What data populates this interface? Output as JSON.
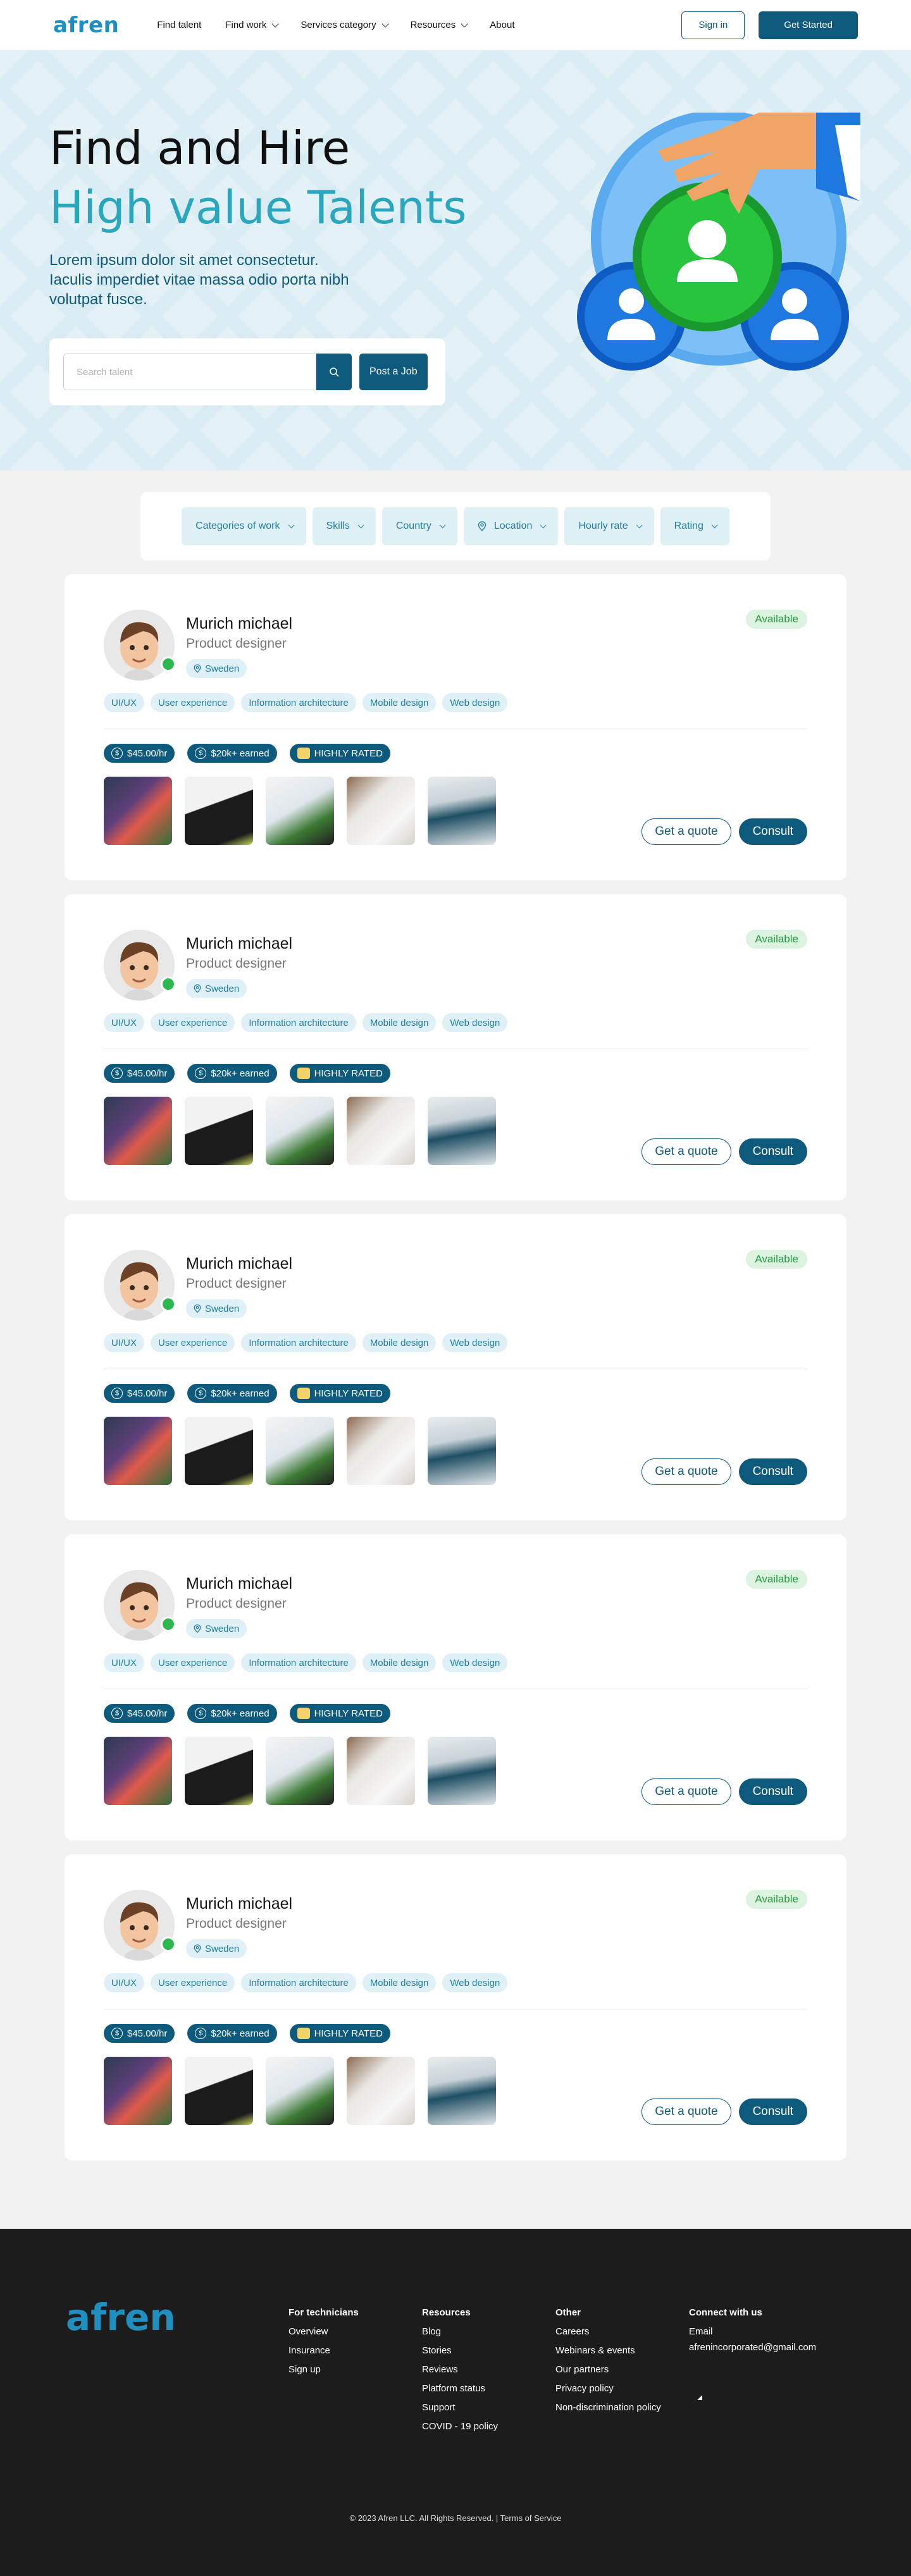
{
  "nav": {
    "logo": "afren",
    "links": [
      "Find talent",
      "Find work",
      "Services category",
      "Resources",
      "About"
    ],
    "signin": "Sign in",
    "get_started": "Get Started"
  },
  "hero": {
    "title_line1": "Find and Hire",
    "title_line2": "High value Talents",
    "subtitle": "Lorem ipsum dolor sit amet consectetur. Iaculis imperdiet vitae massa odio porta nibh volutpat fusce.",
    "search_placeholder": "Search talent",
    "post_job": "Post a Job"
  },
  "filters": [
    "Categories of work",
    "Skills",
    "Country",
    "Location",
    "Hourly rate",
    "Rating"
  ],
  "talents": [
    {
      "name": "Murich michael",
      "role": "Product designer",
      "location": "Sweden",
      "status": "Available",
      "skills": [
        "UI/UX",
        "User experience",
        "Information architecture",
        "Mobile design",
        "Web design"
      ],
      "rate": "$45.00/hr",
      "earned": "$20k+ earned",
      "badge": "HIGHLY RATED",
      "quote": "Get a quote",
      "consult": "Consult"
    },
    {
      "name": "Murich michael",
      "role": "Product designer",
      "location": "Sweden",
      "status": "Available",
      "skills": [
        "UI/UX",
        "User experience",
        "Information architecture",
        "Mobile design",
        "Web design"
      ],
      "rate": "$45.00/hr",
      "earned": "$20k+ earned",
      "badge": "HIGHLY RATED",
      "quote": "Get a quote",
      "consult": "Consult"
    },
    {
      "name": "Murich michael",
      "role": "Product designer",
      "location": "Sweden",
      "status": "Available",
      "skills": [
        "UI/UX",
        "User experience",
        "Information architecture",
        "Mobile design",
        "Web design"
      ],
      "rate": "$45.00/hr",
      "earned": "$20k+ earned",
      "badge": "HIGHLY RATED",
      "quote": "Get a quote",
      "consult": "Consult"
    },
    {
      "name": "Murich michael",
      "role": "Product designer",
      "location": "Sweden",
      "status": "Available",
      "skills": [
        "UI/UX",
        "User experience",
        "Information architecture",
        "Mobile design",
        "Web design"
      ],
      "rate": "$45.00/hr",
      "earned": "$20k+ earned",
      "badge": "HIGHLY RATED",
      "quote": "Get a quote",
      "consult": "Consult"
    },
    {
      "name": "Murich michael",
      "role": "Product designer",
      "location": "Sweden",
      "status": "Available",
      "skills": [
        "UI/UX",
        "User experience",
        "Information architecture",
        "Mobile design",
        "Web design"
      ],
      "rate": "$45.00/hr",
      "earned": "$20k+ earned",
      "badge": "HIGHLY RATED",
      "quote": "Get a quote",
      "consult": "Consult"
    }
  ],
  "footer": {
    "logo": "afren",
    "columns": [
      {
        "heading": "For technicians",
        "items": [
          "Overview",
          "Insurance",
          "Sign up"
        ]
      },
      {
        "heading": "Resources",
        "items": [
          "Blog",
          "Stories",
          "Reviews",
          "Platform status",
          "Support",
          "COVID - 19 policy"
        ]
      },
      {
        "heading": "Other",
        "items": [
          "Careers",
          "Webinars & events",
          "Our partners",
          "Privacy policy",
          "Non-discrimination policy"
        ]
      },
      {
        "heading": "Connect with us",
        "items": [
          "Email",
          "afrenincorporated@gmail.com"
        ]
      }
    ],
    "copyright": "© 2023 Afren  LLC. All Rights Reserved.  |  Terms of Service"
  },
  "colors": {
    "primary": "#0e5a7c",
    "accent": "#2aa7bd",
    "available": "#2bb84e"
  }
}
